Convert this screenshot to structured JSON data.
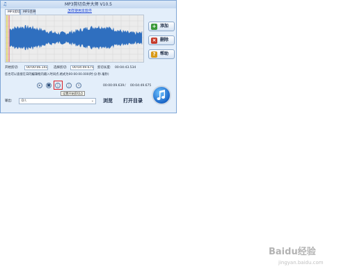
{
  "window": {
    "title": "MP3剪切合并大师 V10.5",
    "tabs": [
      {
        "label": "MP3剪切",
        "active": true
      },
      {
        "label": "MP3合并",
        "active": false
      }
    ],
    "help_link": "怎样使用本软件",
    "icon": "app-icon"
  },
  "side_buttons": [
    {
      "label": "添加",
      "icon": "add-icon"
    },
    {
      "label": "删除",
      "icon": "delete-icon"
    },
    {
      "label": "帮助",
      "icon": "help-icon"
    }
  ],
  "times": {
    "start_label": "开始剪切:",
    "start_value": "00:00:06.141",
    "select_label": "选择剪切:",
    "select_value": "00:04:49.675",
    "duration_label": "剪切长度:",
    "duration_value": "00:04:43.534"
  },
  "hint": "您也可以直接在日的编辑框内输入时间点,格式为00:00:00.000(时:分:秒.毫秒)",
  "playback": {
    "current": "00:00:09.639",
    "separator": "/",
    "total": "00:04:49.675",
    "tooltip": "设置开始剪切点",
    "controls": [
      "play-icon",
      "stop-icon",
      "set-start-icon",
      "set-end-icon",
      "back-icon"
    ]
  },
  "output": {
    "label": "输出:",
    "path": "D:\\",
    "browse_label": "浏览",
    "open_dir_label": "打开目录"
  },
  "watermark": {
    "text": "Baidu经验",
    "sub": "jingyan.baidu.com"
  },
  "colors": {
    "waveform": "#2f6fbf",
    "selection_start": "#d8c84a",
    "selection_end": "#e05050",
    "highlight": "#d81b24"
  }
}
